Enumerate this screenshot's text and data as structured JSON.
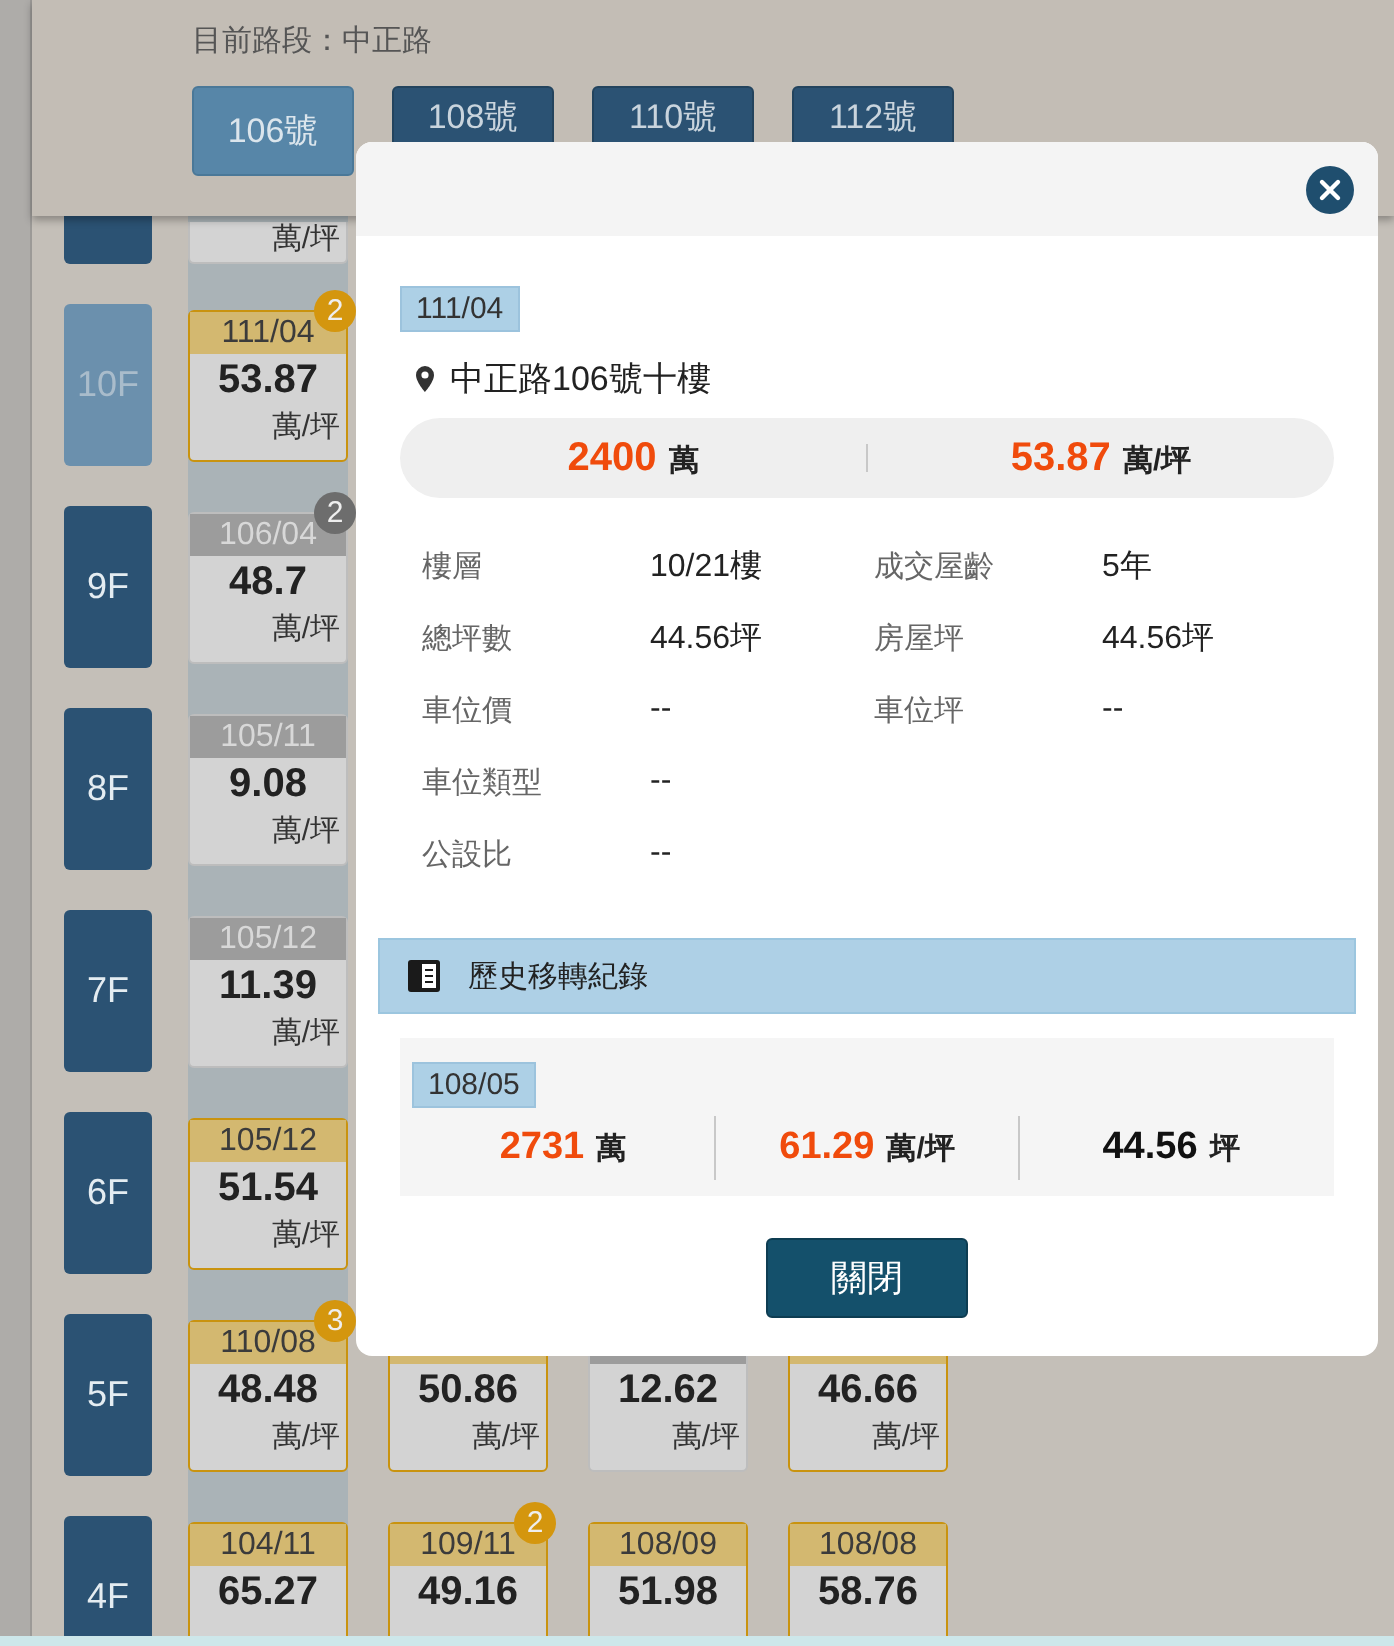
{
  "title": "目前路段：中正路",
  "tabs": [
    {
      "label": "106號",
      "selected": true
    },
    {
      "label": "108號",
      "selected": false
    },
    {
      "label": "110號",
      "selected": false
    },
    {
      "label": "112號",
      "selected": false
    }
  ],
  "floors": [
    {
      "selected": false,
      "cells": [
        {
          "kind": "grey",
          "unit": "萬/坪"
        }
      ]
    },
    {
      "label": "10F",
      "selected": true,
      "cells": [
        {
          "kind": "gold",
          "date": "111/04",
          "price": "53.87",
          "unit": "萬/坪",
          "badge": "2"
        }
      ]
    },
    {
      "label": "9F",
      "selected": false,
      "cells": [
        {
          "kind": "grey",
          "date": "106/04",
          "price": "48.7",
          "unit": "萬/坪",
          "badge": "2"
        }
      ]
    },
    {
      "label": "8F",
      "selected": false,
      "cells": [
        {
          "kind": "grey",
          "date": "105/11",
          "price": "9.08",
          "unit": "萬/坪"
        }
      ]
    },
    {
      "label": "7F",
      "selected": false,
      "cells": [
        {
          "kind": "grey",
          "date": "105/12",
          "price": "11.39",
          "unit": "萬/坪"
        }
      ]
    },
    {
      "label": "6F",
      "selected": false,
      "cells": [
        {
          "kind": "gold",
          "date": "105/12",
          "price": "51.54",
          "unit": "萬/坪"
        }
      ]
    },
    {
      "label": "5F",
      "selected": false,
      "cells": [
        {
          "kind": "gold",
          "date": "110/08",
          "price": "48.48",
          "unit": "萬/坪",
          "badge": "3"
        },
        {
          "kind": "gold",
          "price": "50.86",
          "unit": "萬/坪"
        },
        {
          "kind": "grey",
          "price": "12.62",
          "unit": "萬/坪"
        },
        {
          "kind": "gold",
          "price": "46.66",
          "unit": "萬/坪"
        }
      ]
    },
    {
      "label": "4F",
      "selected": false,
      "cells": [
        {
          "kind": "gold",
          "date": "104/11",
          "price": "65.27"
        },
        {
          "kind": "gold",
          "date": "109/11",
          "price": "49.16",
          "badge": "2"
        },
        {
          "kind": "gold",
          "date": "108/09",
          "price": "51.98"
        },
        {
          "kind": "gold",
          "date": "108/08",
          "price": "58.76"
        }
      ]
    }
  ],
  "modal": {
    "date": "111/04",
    "address": "中正路106號十樓",
    "price": [
      {
        "number": "2400",
        "unit": "萬"
      },
      {
        "number": "53.87",
        "unit": "萬/坪"
      }
    ],
    "detail_rows": [
      [
        {
          "label": "樓層",
          "value": "10/21樓"
        },
        {
          "label": "成交屋齡",
          "value": "5年"
        }
      ],
      [
        {
          "label": "總坪數",
          "value": "44.56坪"
        },
        {
          "label": "房屋坪",
          "value": "44.56坪"
        }
      ],
      [
        {
          "label": "車位價",
          "value": "--"
        },
        {
          "label": "車位坪",
          "value": "--"
        }
      ],
      [
        {
          "label": "車位類型",
          "value": "--"
        }
      ],
      [
        {
          "label": "公設比",
          "value": "--"
        }
      ]
    ],
    "history": {
      "title": "歷史移轉紀錄",
      "records": [
        {
          "date": "108/05",
          "values": [
            {
              "kind": "price",
              "number": "2731",
              "unit": "萬"
            },
            {
              "kind": "price",
              "number": "61.29",
              "unit": "萬/坪"
            },
            {
              "kind": "area",
              "number": "44.56",
              "unit": "坪"
            }
          ]
        }
      ]
    },
    "close_button": "關閉"
  }
}
